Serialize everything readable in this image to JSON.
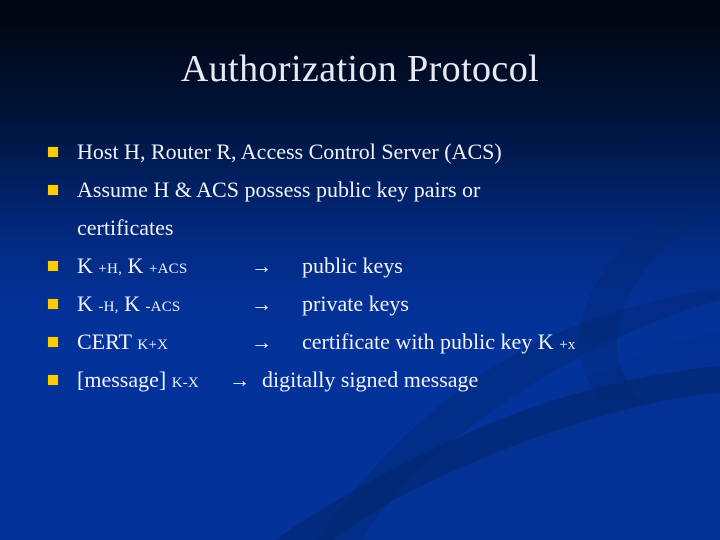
{
  "slide": {
    "title": "Authorization Protocol",
    "background": {
      "top_color": "#000610",
      "bottom_color": "#03339a",
      "accent_swoosh_color": "#042a86"
    },
    "text_color": "#f2f2fb",
    "bullet_color": "#ffcc00",
    "arrow_glyph": "→",
    "bullets": [
      {
        "kind": "plain",
        "text": "Host H, Router R, Access Control Server (ACS)"
      },
      {
        "kind": "plain",
        "text": "Assume H & ACS possess public key pairs or"
      },
      {
        "kind": "continuation",
        "text": "certificates"
      },
      {
        "kind": "notation",
        "term_main": "K",
        "term_sub": "+H,",
        "term_main2": "K",
        "term_sub2": "+ACS",
        "arrow": "→",
        "description": "public keys"
      },
      {
        "kind": "notation",
        "term_main": "K",
        "term_sub": "-H,",
        "term_main2": "K",
        "term_sub2": "-ACS",
        "arrow": "→",
        "description": "private keys"
      },
      {
        "kind": "notation",
        "term_main": "CERT",
        "term_sub": "K+X",
        "arrow": "→",
        "description": "certificate with public key K",
        "description_sub": "+x"
      },
      {
        "kind": "notation",
        "term_main": "[message]",
        "term_sub": "K-X",
        "arrow": "→",
        "description": "digitally signed message"
      }
    ]
  }
}
